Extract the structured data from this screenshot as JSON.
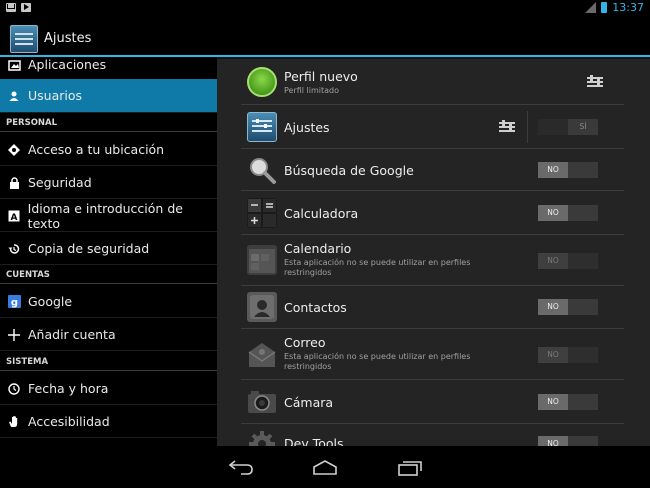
{
  "status_bar": {
    "time": "13:37",
    "icons": [
      "mail-icon",
      "play-icon",
      "signal-icon",
      "battery-icon"
    ]
  },
  "action_bar": {
    "title": "Ajustes"
  },
  "left_pane": {
    "items": [
      {
        "label": "Aplicaciones",
        "icon": "apps-icon"
      },
      {
        "label": "Usuarios",
        "icon": "user-icon",
        "active": true
      },
      {
        "header": "PERSONAL"
      },
      {
        "label": "Acceso a tu ubicación",
        "icon": "location-icon"
      },
      {
        "label": "Seguridad",
        "icon": "lock-icon"
      },
      {
        "label": "Idioma e introducción de texto",
        "icon": "keyboard-icon"
      },
      {
        "label": "Copia de seguridad",
        "icon": "backup-icon"
      },
      {
        "header": "CUENTAS"
      },
      {
        "label": "Google",
        "icon": "google-icon"
      },
      {
        "label": "Añadir cuenta",
        "icon": "add-icon"
      },
      {
        "header": "SISTEMA"
      },
      {
        "label": "Fecha y hora",
        "icon": "clock-icon"
      },
      {
        "label": "Accesibilidad",
        "icon": "hand-icon"
      }
    ]
  },
  "profile": {
    "name": "Perfil nuevo",
    "subtitle": "Perfil limitado"
  },
  "apps": [
    {
      "name": "Ajustes",
      "toggle": "SÍ",
      "state": "on"
    },
    {
      "name": "Búsqueda de Google",
      "toggle": "NO",
      "state": "off"
    },
    {
      "name": "Calculadora",
      "toggle": "NO",
      "state": "off"
    },
    {
      "name": "Calendario",
      "subtitle": "Esta aplicación no se puede utilizar en perfiles restringidos",
      "toggle": "NO",
      "state": "disabled"
    },
    {
      "name": "Contactos",
      "toggle": "NO",
      "state": "off"
    },
    {
      "name": "Correo",
      "subtitle": "Esta aplicación no se puede utilizar en perfiles restringidos",
      "toggle": "NO",
      "state": "disabled"
    },
    {
      "name": "Cámara",
      "toggle": "NO",
      "state": "off"
    },
    {
      "name": "Dev Tools",
      "toggle": "NO",
      "state": "off"
    }
  ],
  "colors": {
    "accent": "#33b5e5",
    "active_item": "#0f7aa8",
    "profile_green": "#63b22e"
  }
}
